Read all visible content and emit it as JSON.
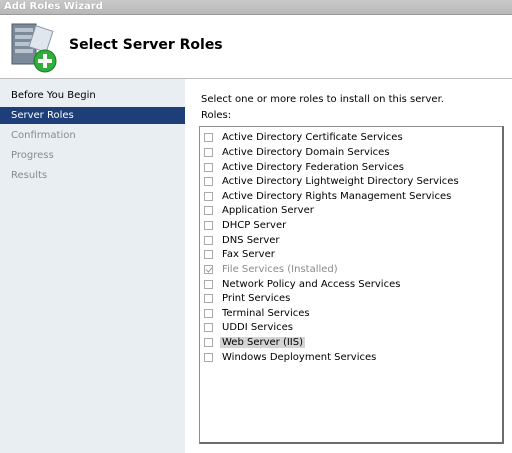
{
  "window": {
    "title": "Add Roles Wizard"
  },
  "header": {
    "title": "Select Server Roles",
    "icon": "server-add-icon"
  },
  "sidebar": {
    "items": [
      {
        "label": "Before You Begin",
        "state": "done"
      },
      {
        "label": "Server Roles",
        "state": "active"
      },
      {
        "label": "Confirmation",
        "state": "pending"
      },
      {
        "label": "Progress",
        "state": "pending"
      },
      {
        "label": "Results",
        "state": "pending"
      }
    ]
  },
  "main": {
    "instruction": "Select one or more roles to install on this server.",
    "roles_label": "Roles:",
    "roles": [
      {
        "label": "Active Directory Certificate Services",
        "checked": false,
        "disabled": false
      },
      {
        "label": "Active Directory Domain Services",
        "checked": false,
        "disabled": false
      },
      {
        "label": "Active Directory Federation Services",
        "checked": false,
        "disabled": false
      },
      {
        "label": "Active Directory Lightweight Directory Services",
        "checked": false,
        "disabled": false
      },
      {
        "label": "Active Directory Rights Management Services",
        "checked": false,
        "disabled": false
      },
      {
        "label": "Application Server",
        "checked": false,
        "disabled": false
      },
      {
        "label": "DHCP Server",
        "checked": false,
        "disabled": false
      },
      {
        "label": "DNS Server",
        "checked": false,
        "disabled": false
      },
      {
        "label": "Fax Server",
        "checked": false,
        "disabled": false
      },
      {
        "label": "File Services  (Installed)",
        "checked": true,
        "disabled": true
      },
      {
        "label": "Network Policy and Access Services",
        "checked": false,
        "disabled": false
      },
      {
        "label": "Print Services",
        "checked": false,
        "disabled": false
      },
      {
        "label": "Terminal Services",
        "checked": false,
        "disabled": false
      },
      {
        "label": "UDDI Services",
        "checked": false,
        "disabled": false
      },
      {
        "label": "Web Server (IIS)",
        "checked": false,
        "disabled": false,
        "selected": true
      },
      {
        "label": "Windows Deployment Services",
        "checked": false,
        "disabled": false
      }
    ]
  },
  "colors": {
    "nav_active_bg": "#1e3e7a",
    "sidebar_bg": "#e9eef2",
    "disabled_text": "#8a8a8a"
  }
}
